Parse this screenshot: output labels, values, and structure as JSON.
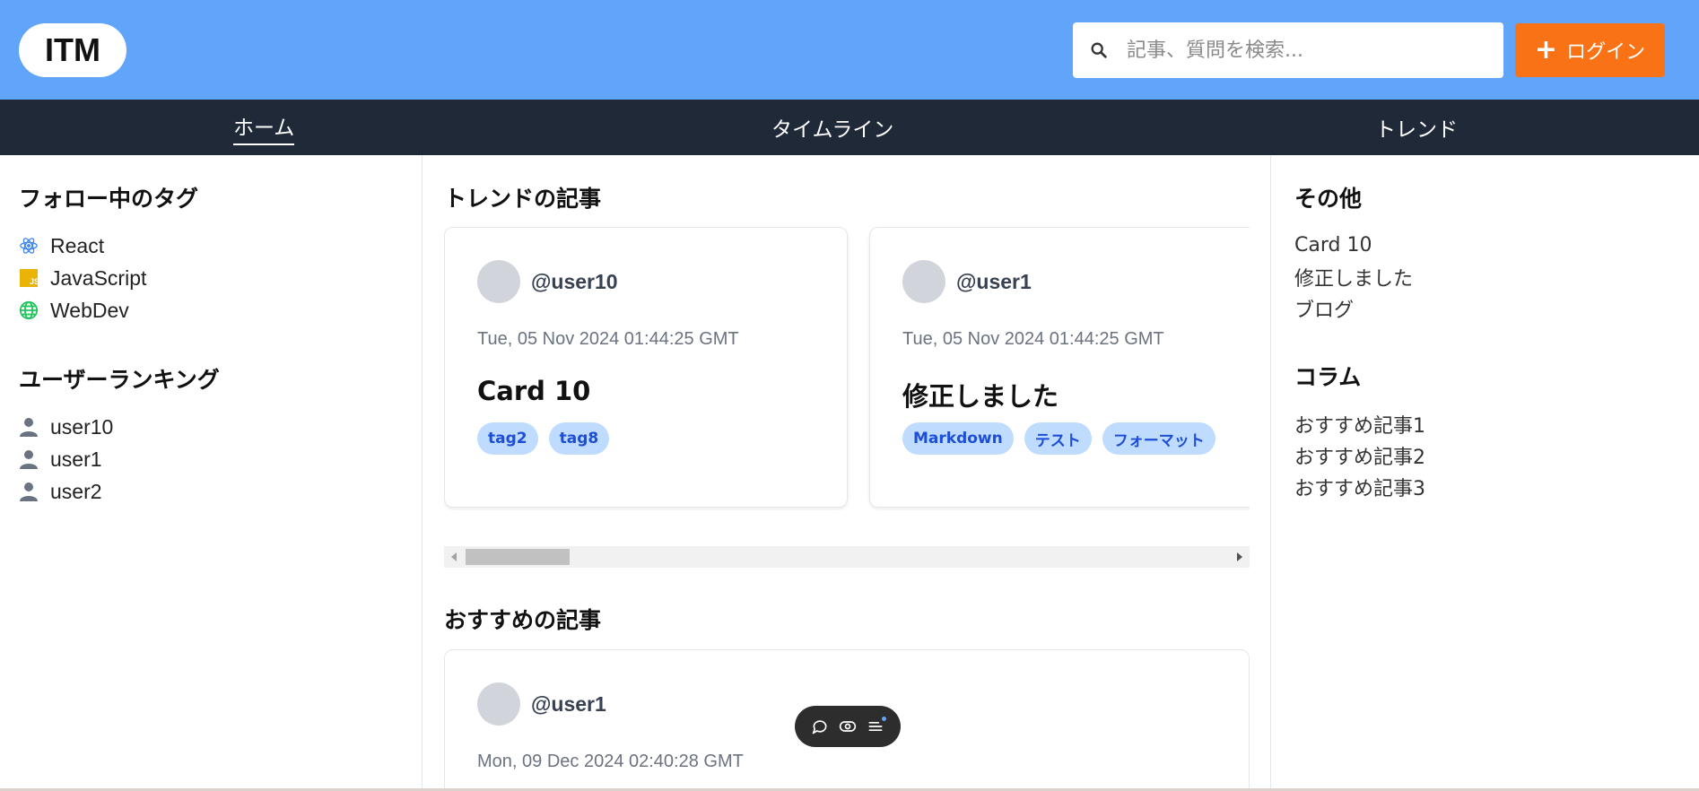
{
  "header": {
    "logo": "ITM",
    "search_placeholder": "記事、質問を検索...",
    "login_label": "ログイン"
  },
  "nav": {
    "items": [
      {
        "label": "ホーム",
        "active": true
      },
      {
        "label": "タイムライン",
        "active": false
      },
      {
        "label": "トレンド",
        "active": false
      }
    ]
  },
  "left": {
    "followed_tags_title": "フォロー中のタグ",
    "followed_tags": [
      {
        "label": "React",
        "icon": "react-icon"
      },
      {
        "label": "JavaScript",
        "icon": "javascript-icon"
      },
      {
        "label": "WebDev",
        "icon": "globe-icon"
      }
    ],
    "ranking_title": "ユーザーランキング",
    "ranking": [
      {
        "label": "user10"
      },
      {
        "label": "user1"
      },
      {
        "label": "user2"
      }
    ]
  },
  "center": {
    "trend_title": "トレンドの記事",
    "trend_cards": [
      {
        "user": "@user10",
        "date": "Tue, 05 Nov 2024 01:44:25 GMT",
        "title": "Card 10",
        "tags": [
          "tag2",
          "tag8"
        ]
      },
      {
        "user": "@user1",
        "date": "Tue, 05 Nov 2024 01:44:25 GMT",
        "title": "修正しました",
        "tags": [
          "Markdown",
          "テスト",
          "フォーマット"
        ]
      }
    ],
    "recommended_title": "おすすめの記事",
    "recommended_cards": [
      {
        "user": "@user1",
        "date": "Mon, 09 Dec 2024 02:40:28 GMT"
      }
    ]
  },
  "right": {
    "other_title": "その他",
    "other_items": [
      "Card 10",
      "修正しました",
      "ブログ"
    ],
    "column_title": "コラム",
    "column_items": [
      "おすすめ記事1",
      "おすすめ記事2",
      "おすすめ記事3"
    ]
  },
  "colors": {
    "header_bg": "#60a5fa",
    "nav_bg": "#1f2937",
    "login_bg": "#f97316",
    "tag_bg": "#bfdbfe",
    "tag_text": "#1d4ed8"
  }
}
